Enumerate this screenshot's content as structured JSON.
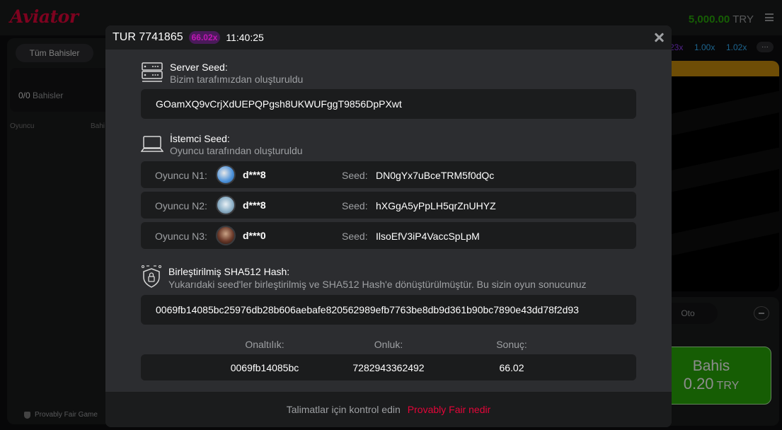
{
  "app": {
    "logo": "Aviator",
    "balance": "5,000.00",
    "currency": "TRY"
  },
  "left_panel": {
    "tab_all_bets": "Tüm Bahisler",
    "bets_count": "0/0",
    "bets_label": "Bahisler",
    "col_player": "Oyuncu",
    "col_bet": "Bahi",
    "fair_game": "Provably Fair Game"
  },
  "history": [
    {
      "value": "23x",
      "color": "#913ef8"
    },
    {
      "value": "1.00x",
      "color": "#34b4ff"
    },
    {
      "value": "1.02x",
      "color": "#34b4ff"
    }
  ],
  "history_more": "···",
  "bet_panel": {
    "auto_tab": "Oto",
    "bet_label": "Bahis",
    "bet_amount": "0.20",
    "bet_currency": "TRY"
  },
  "modal": {
    "round_title": "TUR 7741865",
    "multiplier": "66.02x",
    "time": "11:40:25",
    "server_seed": {
      "title": "Server Seed:",
      "subtitle": "Bizim tarafımızdan oluşturuldu",
      "value": "GOamXQ9vCrjXdUEPQPgsh8UKWUFggT9856DpPXwt"
    },
    "client_seed": {
      "title": "İstemci Seed:",
      "subtitle": "Oyuncu tarafından oluşturuldu",
      "seed_label": "Seed:",
      "players": [
        {
          "label": "Oyuncu N1:",
          "name": "d***8",
          "seed": "DN0gYx7uBceTRM5f0dQc",
          "avatar_color": "#4a90d9"
        },
        {
          "label": "Oyuncu N2:",
          "name": "d***8",
          "seed": "hXGgA5yPpLH5qrZnUHYZ",
          "avatar_color": "#8fb2c9"
        },
        {
          "label": "Oyuncu N3:",
          "name": "d***0",
          "seed": "IlsoEfV3iP4VaccSpLpM",
          "avatar_color": "#6b3a2a"
        }
      ]
    },
    "hash": {
      "title": "Birleştirilmiş SHA512 Hash:",
      "subtitle": "Yukarıdaki seed'ler birleştirilmiş ve SHA512 Hash'e dönüştürülmüştür. Bu sizin oyun sonucunuz",
      "value": "0069fb14085bc25976db28b606aebafe820562989efb7763be8db9d361b90bc7890e43dd78f2d93"
    },
    "result": {
      "hex_label": "Onaltılık:",
      "dec_label": "Onluk:",
      "result_label": "Sonuç:",
      "hex_value": "0069fb14085bc",
      "dec_value": "7282943362492",
      "result_value": "66.02"
    },
    "footer": {
      "text": "Talimatlar için kontrol edin",
      "link": "Provably Fair nedir"
    }
  }
}
